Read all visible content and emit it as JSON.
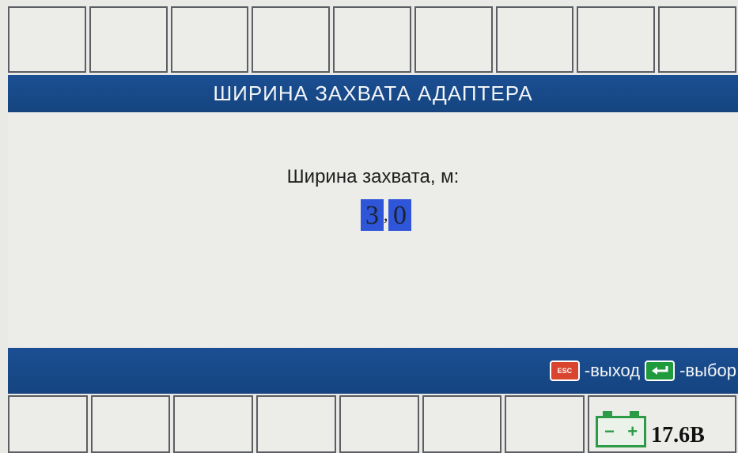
{
  "header": {
    "title": "ШИРИНА ЗАХВАТА АДАПТЕРА"
  },
  "field": {
    "label": "Ширина захвата, м:",
    "digit_int": "3",
    "separator": ",",
    "digit_frac": "0"
  },
  "help": {
    "esc_key": "ESC",
    "esc_text": "-выход",
    "enter_text": "-выбор"
  },
  "status": {
    "battery_minus": "−",
    "battery_plus": "+",
    "voltage": "17.6В"
  },
  "colors": {
    "bar_blue": "#1a4b8c",
    "digit_highlight": "#2f55d8",
    "esc_red": "#d8442e",
    "enter_green": "#1f9b3d",
    "battery_green": "#2d9b45"
  }
}
